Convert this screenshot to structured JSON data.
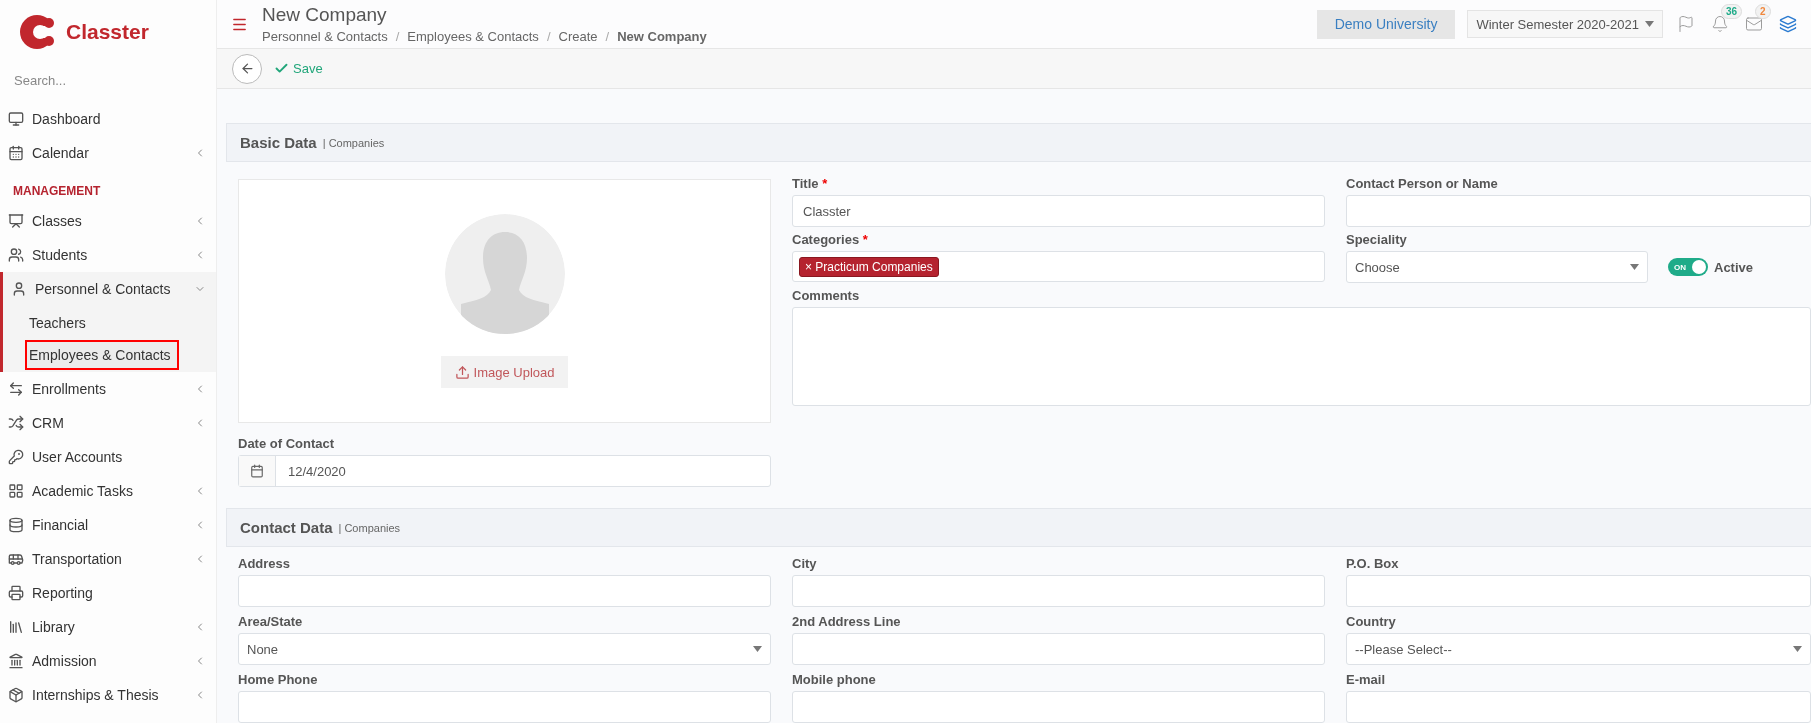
{
  "app": {
    "name": "Classter"
  },
  "sidebar": {
    "search_placeholder": "Search...",
    "items": [
      {
        "kind": "item",
        "label": "Dashboard",
        "has_submenu": false,
        "selected": false
      },
      {
        "kind": "item",
        "label": "Calendar",
        "has_submenu": true,
        "expanded": false,
        "selected": false
      },
      {
        "kind": "heading",
        "label": "MANAGEMENT"
      },
      {
        "kind": "item",
        "label": "Classes",
        "has_submenu": true,
        "expanded": false,
        "selected": false
      },
      {
        "kind": "item",
        "label": "Students",
        "has_submenu": true,
        "expanded": false,
        "selected": false
      },
      {
        "kind": "item",
        "label": "Personnel & Contacts",
        "has_submenu": true,
        "expanded": true,
        "selected": false,
        "children": [
          {
            "label": "Teachers",
            "selected": false
          },
          {
            "label": "Employees & Contacts",
            "selected": true
          }
        ]
      },
      {
        "kind": "item",
        "label": "Enrollments",
        "has_submenu": true,
        "expanded": false,
        "selected": false
      },
      {
        "kind": "item",
        "label": "CRM",
        "has_submenu": true,
        "expanded": false,
        "selected": false
      },
      {
        "kind": "item",
        "label": "User Accounts",
        "has_submenu": false,
        "selected": false
      },
      {
        "kind": "item",
        "label": "Academic Tasks",
        "has_submenu": true,
        "expanded": false,
        "selected": false
      },
      {
        "kind": "item",
        "label": "Financial",
        "has_submenu": true,
        "expanded": false,
        "selected": false
      },
      {
        "kind": "item",
        "label": "Transportation",
        "has_submenu": true,
        "expanded": false,
        "selected": false
      },
      {
        "kind": "item",
        "label": "Reporting",
        "has_submenu": false,
        "selected": false
      },
      {
        "kind": "item",
        "label": "Library",
        "has_submenu": true,
        "expanded": false,
        "selected": false
      },
      {
        "kind": "item",
        "label": "Admission",
        "has_submenu": true,
        "expanded": false,
        "selected": false
      },
      {
        "kind": "item",
        "label": "Internships & Thesis",
        "has_submenu": true,
        "expanded": false,
        "selected": false
      }
    ]
  },
  "header": {
    "title": "New Company",
    "breadcrumb_separator": "/",
    "breadcrumbs": [
      "Personnel & Contacts",
      "Employees & Contacts",
      "Create",
      "New Company"
    ],
    "institution": "Demo University",
    "semester": "Winter Semester 2020-2021",
    "notifications": "36",
    "messages": "2"
  },
  "toolbar": {
    "save": "Save"
  },
  "basic_data": {
    "title": "Basic Data",
    "subtitle": "| Companies",
    "image_upload": "Image Upload",
    "date_of_contact": {
      "label": "Date of Contact",
      "value": "12/4/2020"
    },
    "fields": [
      {
        "kind": "text",
        "label": "Title",
        "required_mark": "*",
        "value": "Classter"
      },
      {
        "kind": "text",
        "label": "Contact Person or Name"
      },
      {
        "kind": "tags",
        "label": "Categories",
        "required_mark": "*",
        "tags": [
          {
            "remove": "×",
            "label": "Practicum Companies"
          }
        ]
      },
      {
        "kind": "select",
        "label": "Speciality",
        "value": "Choose"
      }
    ],
    "active": {
      "label": "Active",
      "on": true,
      "on_text": "ON"
    },
    "comments": {
      "label": "Comments"
    }
  },
  "contact_data": {
    "title": "Contact Data",
    "subtitle": "| Companies",
    "fields": [
      {
        "kind": "text",
        "label": "Address"
      },
      {
        "kind": "text",
        "label": "City"
      },
      {
        "kind": "text",
        "label": "P.O. Box"
      },
      {
        "kind": "select",
        "label": "Area/State",
        "value": "None"
      },
      {
        "kind": "text",
        "label": "2nd Address Line"
      },
      {
        "kind": "select",
        "label": "Country",
        "value": "--Please Select--"
      },
      {
        "kind": "text",
        "label": "Home Phone"
      },
      {
        "kind": "text",
        "label": "Mobile phone"
      },
      {
        "kind": "text",
        "label": "E-mail"
      }
    ]
  }
}
